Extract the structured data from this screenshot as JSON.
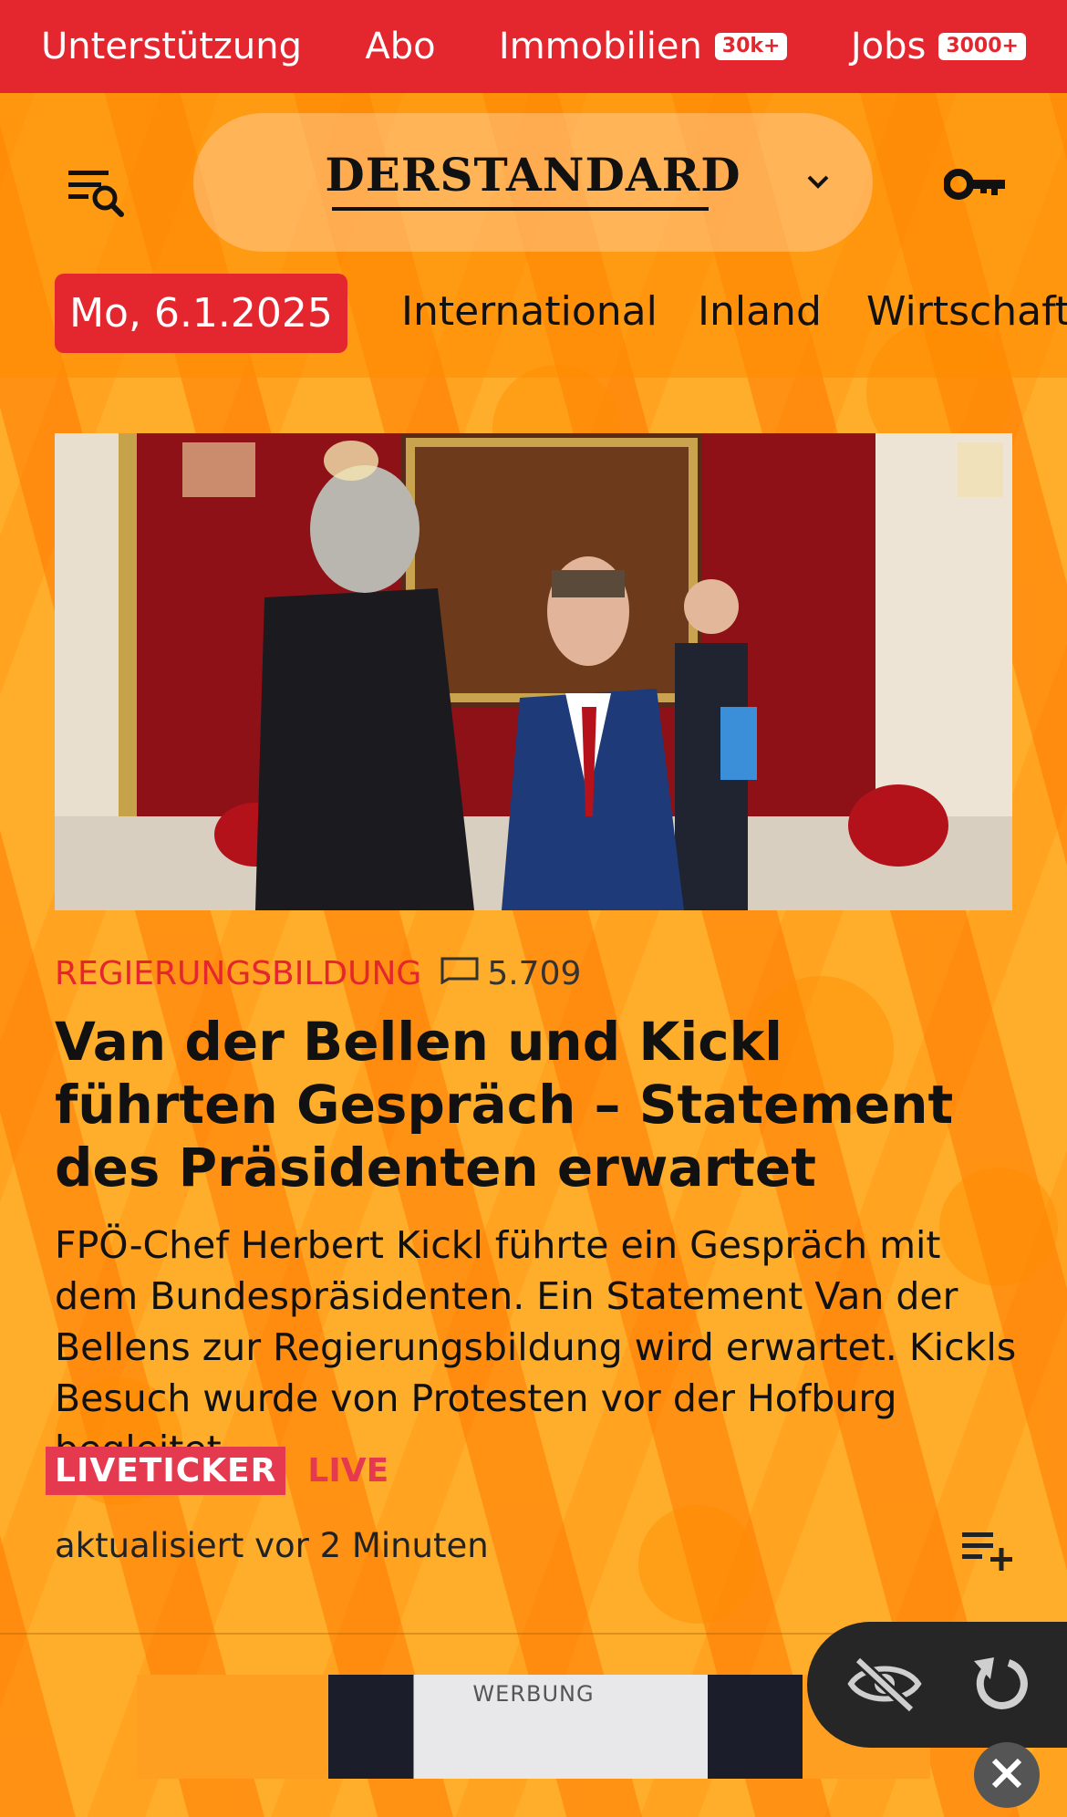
{
  "topbar": {
    "items": [
      {
        "label": "Unterstützung",
        "badge": null
      },
      {
        "label": "Abo",
        "badge": null
      },
      {
        "label": "Immobilien",
        "badge": "30k+"
      },
      {
        "label": "Jobs",
        "badge": "3000+"
      }
    ]
  },
  "header": {
    "logo_text": "DERSTANDARD"
  },
  "nav": {
    "date": "Mo, 6.1.2025",
    "links": [
      "International",
      "Inland",
      "Wirtschaft"
    ]
  },
  "article": {
    "kicker": "REGIERUNGSBILDUNG",
    "comment_count": "5.709",
    "headline": "Van der Bellen und Kickl führten Gespräch – Statement des Präsidenten erwartet",
    "teaser": "FPÖ-Chef Herbert Kickl führte ein Gespräch mit dem Bundespräsidenten. Ein Statement Van der Bellens zur Regierungsbildung wird erwartet. Kickls Besuch wurde von Protesten vor der Hofburg begleitet",
    "liveticker_label": "LIVETICKER",
    "live_label": "LIVE",
    "updated": "aktualisiert vor 2 Minuten"
  },
  "ad": {
    "label": "WERBUNG"
  },
  "colors": {
    "accent_red": "#e4262f",
    "background_orange": "#ffae2b",
    "live_pink": "#e4394f"
  },
  "icons": {
    "menu": "menu-search-icon",
    "chevron": "chevron-down-icon",
    "key": "key-icon",
    "comment": "comment-icon",
    "watchlist": "playlist-add-icon",
    "hide": "eye-off-icon",
    "reload": "reload-icon",
    "close": "close-icon"
  }
}
